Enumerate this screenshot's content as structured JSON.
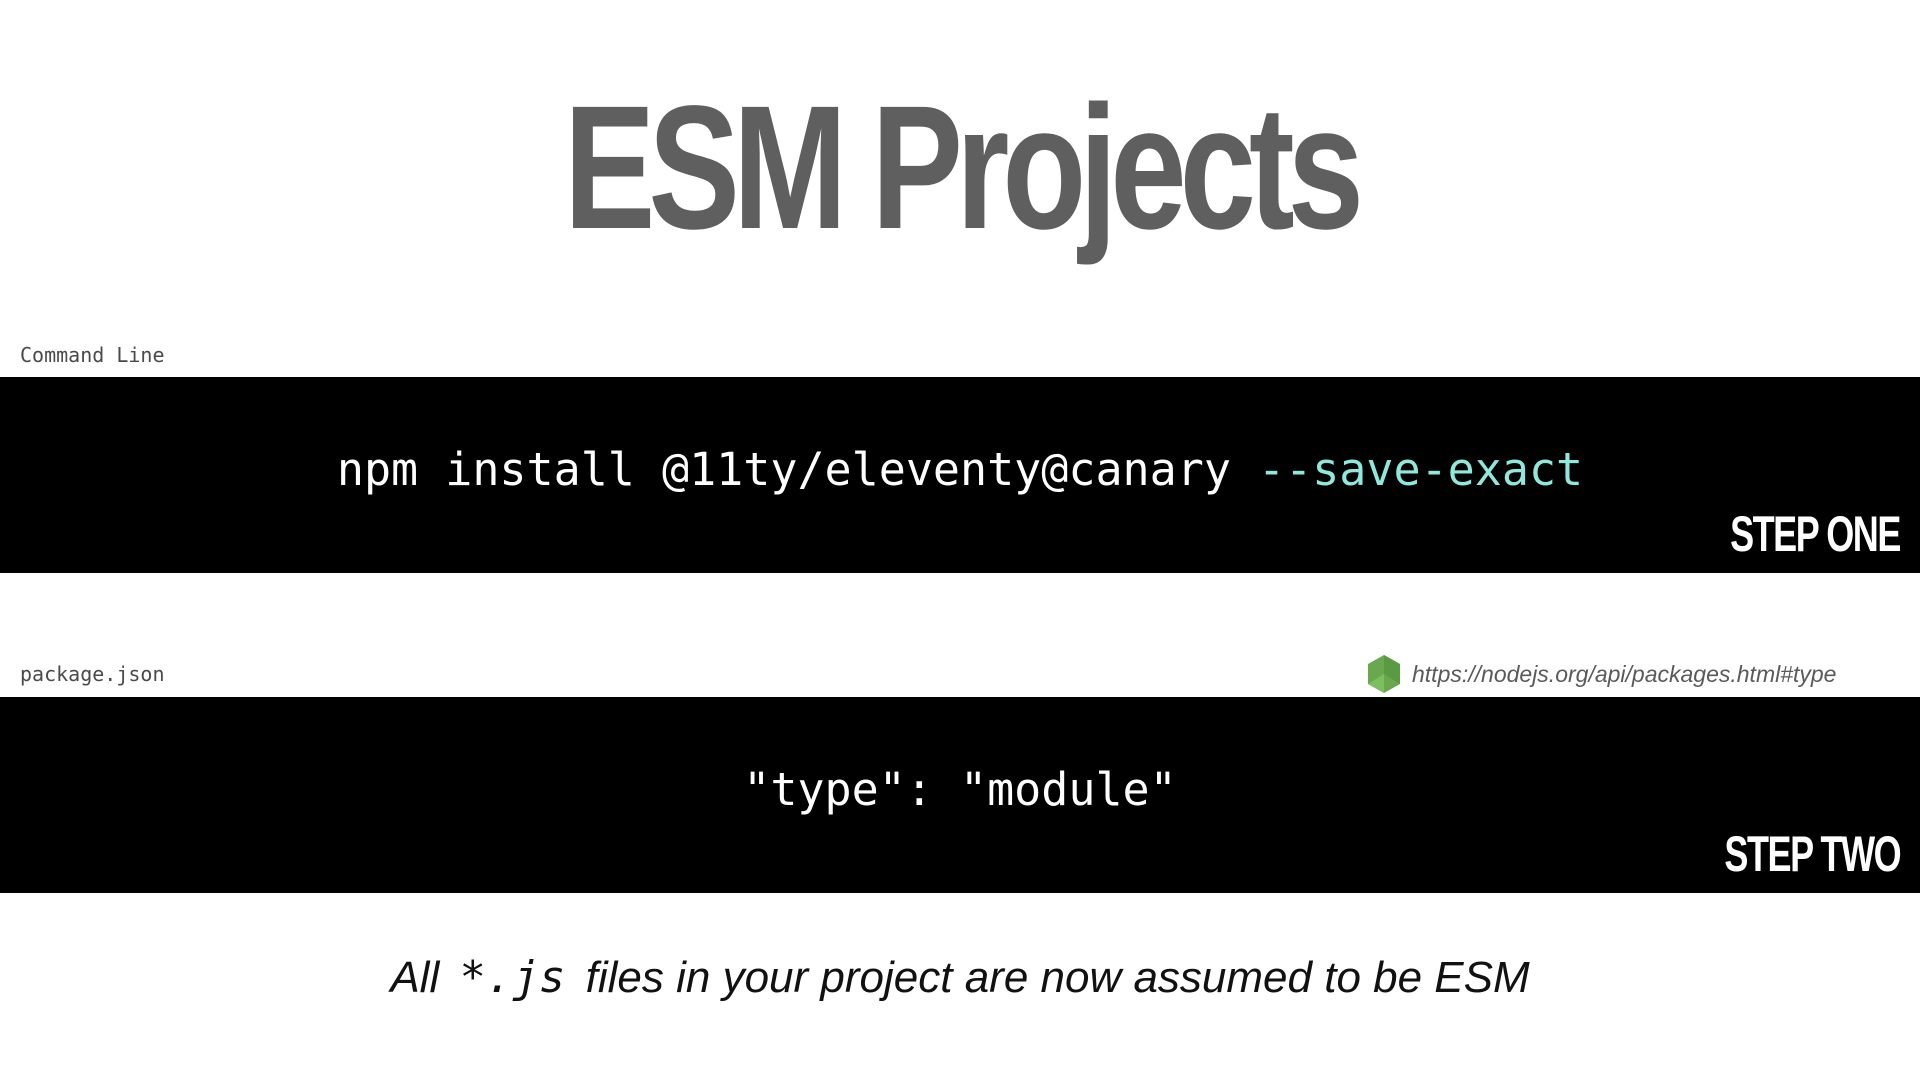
{
  "slide": {
    "title": "ESM Projects",
    "colors": {
      "title": "#5f5f5f",
      "band": "#000000",
      "code_text": "#ffffff",
      "code_flag": "#8fe8dc",
      "node_icon": "#6aa84f"
    }
  },
  "step_one": {
    "label": "Command Line",
    "command": "npm install @11ty/eleventy@canary ",
    "flag": "--save-exact",
    "step_label": "STEP ONE"
  },
  "step_two": {
    "label": "package.json",
    "code": "\"type\": \"module\"",
    "step_label": "STEP TWO",
    "link_icon": "nodejs-hexagon-icon",
    "link_url": "https://nodejs.org/api/packages.html#type"
  },
  "caption": {
    "before": "All ",
    "code": "*.js",
    "after": " files in your project are now assumed to be ESM"
  }
}
